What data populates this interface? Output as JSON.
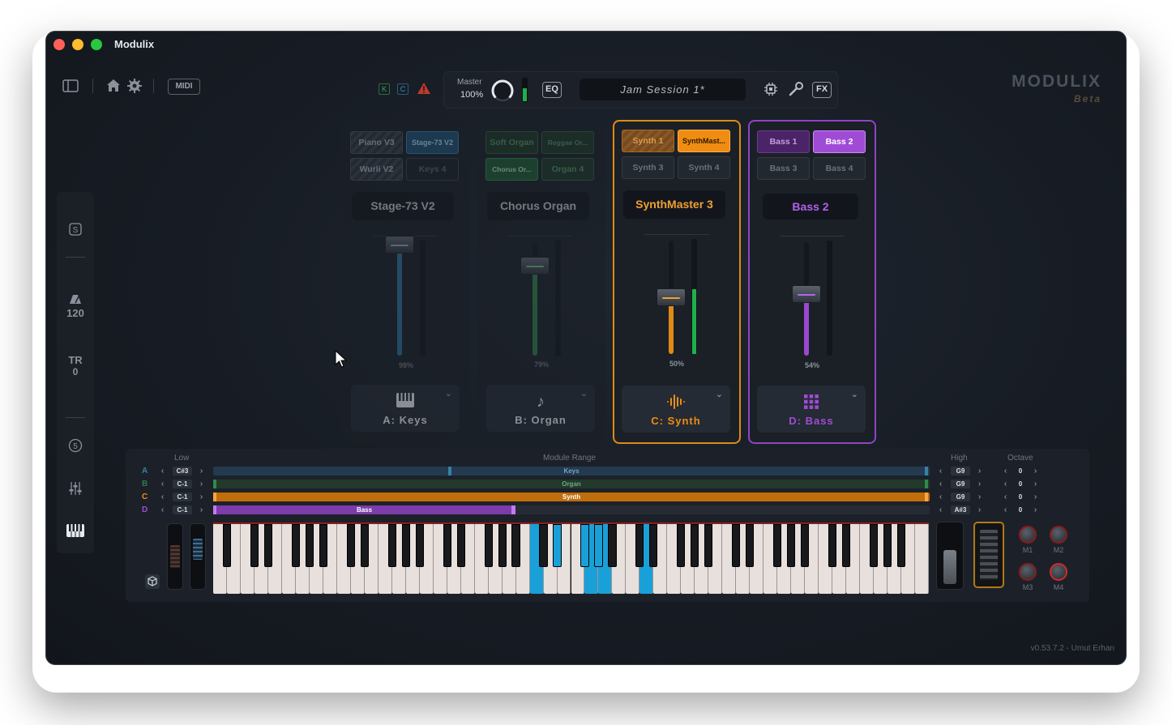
{
  "window": {
    "title": "Modulix",
    "version": "v0.53.7.2 - Umut Erhan"
  },
  "colors": {
    "keys": "#3a7fa8",
    "organ": "#2f7a45",
    "synth": "#f08c12",
    "bass": "#a04bd6",
    "accent_keys_highlight": "#1aa0d8"
  },
  "toolbar": {
    "midi_label": "MIDI",
    "k_label": "K",
    "c_label": "C",
    "master_label": "Master",
    "master_value": "100%",
    "eq_label": "EQ",
    "session_name": "Jam Session 1*",
    "fx_label": "FX"
  },
  "brand": {
    "name": "MODULIX",
    "tag": "Beta"
  },
  "sidebar": {
    "tempo": "120",
    "tr_label": "TR",
    "tr_value": "0",
    "step_label": "5"
  },
  "strips": [
    {
      "id": "A",
      "presets": [
        "Piano V3",
        "Stage-73 V2",
        "Wurli V2",
        "Keys 4"
      ],
      "display": "Stage-73 V2",
      "level": "98%",
      "level_value": 0.98,
      "module": "A: Keys"
    },
    {
      "id": "B",
      "presets": [
        "Soft Organ",
        "Reggae Or...",
        "Chorus Or...",
        "Organ 4"
      ],
      "display": "Chorus Organ",
      "level": "79%",
      "level_value": 0.79,
      "module": "B: Organ"
    },
    {
      "id": "C",
      "presets": [
        "Synth 1",
        "SynthMast...",
        "Synth 3",
        "Synth 4"
      ],
      "display": "SynthMaster 3",
      "level": "50%",
      "level_value": 0.5,
      "module": "C: Synth"
    },
    {
      "id": "D",
      "presets": [
        "Bass 1",
        "Bass 2",
        "Bass 3",
        "Bass 4"
      ],
      "display": "Bass 2",
      "level": "54%",
      "level_value": 0.54,
      "module": "D: Bass"
    }
  ],
  "range": {
    "low_header": "Low",
    "mid_header": "Module Range",
    "high_header": "High",
    "octave_header": "Octave",
    "rows": [
      {
        "letter": "A",
        "low": "C#3",
        "name": "Keys",
        "high": "G9",
        "octave": "0"
      },
      {
        "letter": "B",
        "low": "C-1",
        "name": "Organ",
        "high": "G9",
        "octave": "0"
      },
      {
        "letter": "C",
        "low": "C-1",
        "name": "Synth",
        "high": "G9",
        "octave": "0"
      },
      {
        "letter": "D",
        "low": "C-1",
        "name": "Bass",
        "high": "A#3",
        "octave": "0"
      }
    ]
  },
  "macros": [
    "M1",
    "M2",
    "M3",
    "M4"
  ]
}
